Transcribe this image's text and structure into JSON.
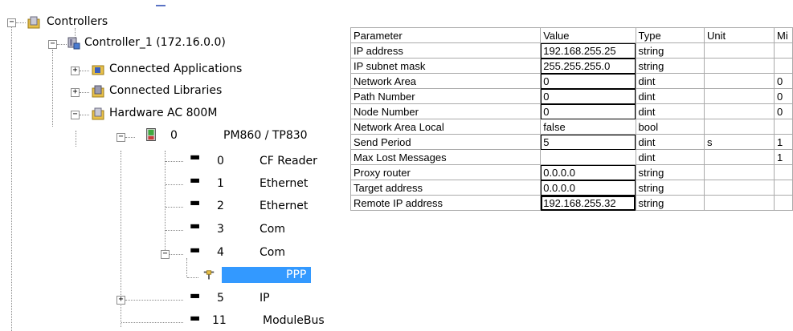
{
  "tree": {
    "root_label": "Controllers",
    "controller_label": "Controller_1 (172.16.0.0)",
    "connected_apps": "Connected Applications",
    "connected_libs": "Connected Libraries",
    "hardware": "Hardware  AC 800M",
    "cpu": {
      "pos": "0",
      "name": "PM860 / TP830"
    },
    "units": [
      {
        "pos": "0",
        "name": "CF Reader"
      },
      {
        "pos": "1",
        "name": "Ethernet"
      },
      {
        "pos": "2",
        "name": "Ethernet"
      },
      {
        "pos": "3",
        "name": "Com"
      },
      {
        "pos": "4",
        "name": "Com"
      }
    ],
    "ppp": "PPP",
    "ip_unit": {
      "pos": "5",
      "name": "IP"
    },
    "modulebus": {
      "pos": "11",
      "name": "ModuleBus"
    }
  },
  "grid": {
    "headers": [
      "Parameter",
      "Value",
      "Type",
      "Unit",
      "Mi"
    ],
    "rows": [
      [
        "IP address",
        "192.168.255.25",
        "string",
        "",
        ""
      ],
      [
        "IP subnet mask",
        "255.255.255.0",
        "string",
        "",
        ""
      ],
      [
        "Network Area",
        "0",
        "dint",
        "",
        "0"
      ],
      [
        "Path Number",
        "0",
        "dint",
        "",
        "0"
      ],
      [
        "Node Number",
        "0",
        "dint",
        "",
        "0"
      ],
      [
        "Network Area Local",
        "false",
        "bool",
        "",
        ""
      ],
      [
        "Send Period",
        "5",
        "dint",
        "s",
        "1"
      ],
      [
        "Max Lost Messages",
        "",
        "dint",
        "",
        "1"
      ],
      [
        "Proxy router",
        "0.0.0.0",
        "string",
        "",
        ""
      ],
      [
        "Target address",
        "0.0.0.0",
        "string",
        "",
        ""
      ],
      [
        "Remote IP address",
        "192.168.255.32",
        "string",
        "",
        ""
      ]
    ]
  },
  "colors": {
    "selection": "#3399ff",
    "gridline": "#aaaaaa"
  },
  "icons": [
    "folder-icon",
    "controller-icon",
    "application-icon",
    "library-icon",
    "hardware-icon",
    "cpu-icon",
    "connector-icon",
    "ppp-icon"
  ]
}
